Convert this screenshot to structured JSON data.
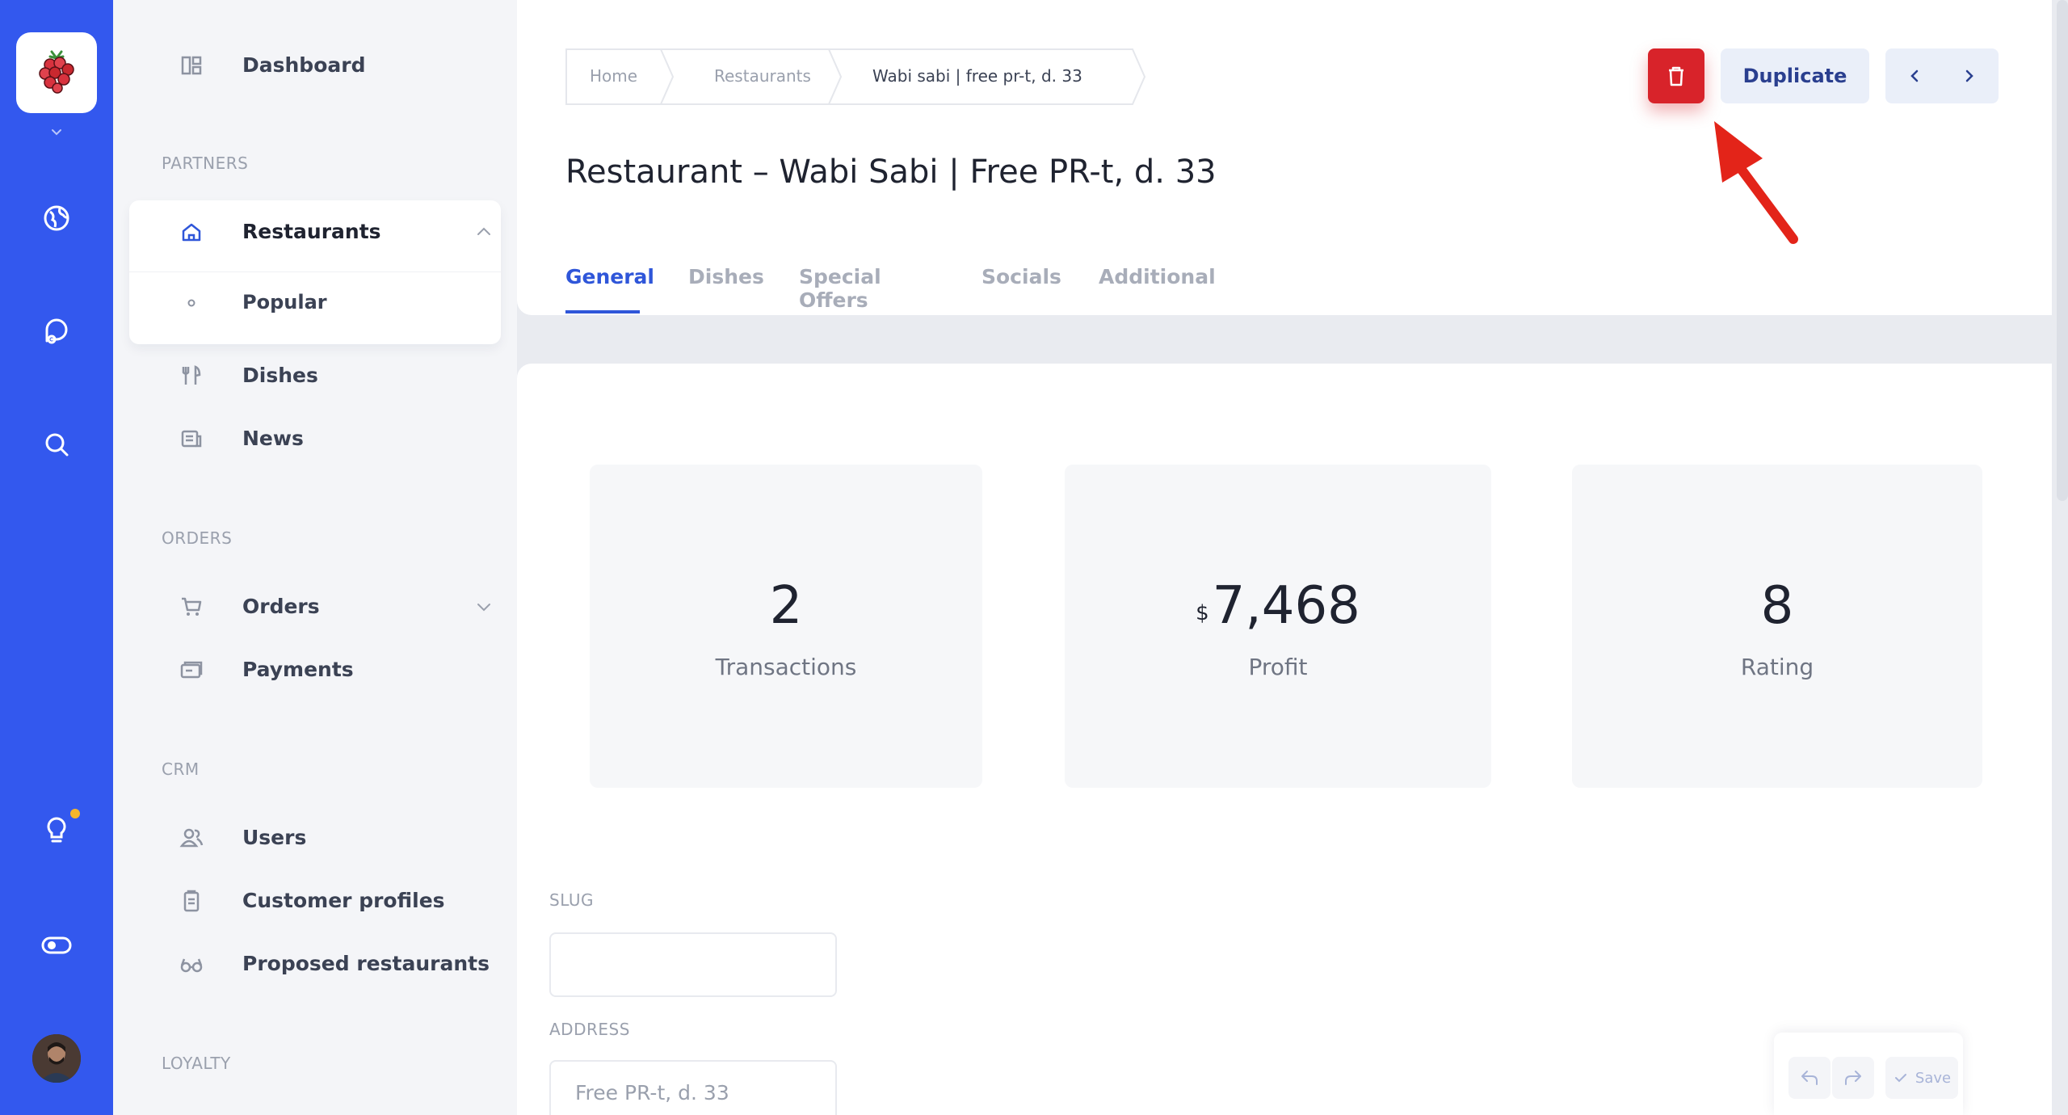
{
  "sidebar": {
    "dashboard": "Dashboard",
    "sections": [
      "PARTNERS",
      "ORDERS",
      "CRM",
      "LOYALTY"
    ],
    "restaurants": "Restaurants",
    "popular": "Popular",
    "dishes": "Dishes",
    "news": "News",
    "orders": "Orders",
    "payments": "Payments",
    "users": "Users",
    "customer_profiles": "Customer profiles",
    "proposed_restaurants": "Proposed restaurants"
  },
  "breadcrumb": [
    "Home",
    "Restaurants",
    "Wabi sabi | free pr-t, d. 33"
  ],
  "page_title": "Restaurant – Wabi Sabi | Free PR-t, d. 33",
  "tabs": [
    "General",
    "Dishes",
    "Special Offers",
    "Socials",
    "Additional"
  ],
  "actions": {
    "duplicate": "Duplicate"
  },
  "stats": [
    {
      "value": "2",
      "label": "Transactions"
    },
    {
      "currency": "$",
      "value": "7,468",
      "label": "Profit"
    },
    {
      "value": "8",
      "label": "Rating"
    }
  ],
  "form": {
    "slug_label": "SLUG",
    "slug_value": "",
    "address_label": "ADDRESS",
    "address_placeholder": "Free PR-t, d. 33"
  },
  "save_bar": {
    "save": "Save"
  },
  "colors": {
    "rail": "#3358ee",
    "accent": "#2f56d9",
    "delete": "#d8232a",
    "notification": "#f5b62a"
  },
  "icons": {
    "rail": [
      "globe-icon",
      "chat-icon",
      "search-icon",
      "lightbulb-icon",
      "toggle-icon"
    ],
    "nav": [
      "dashboard-icon",
      "home-icon",
      "dot-icon",
      "utensils-icon",
      "news-icon",
      "cart-icon",
      "wallet-icon",
      "users-icon",
      "clipboard-icon",
      "glasses-icon"
    ]
  }
}
